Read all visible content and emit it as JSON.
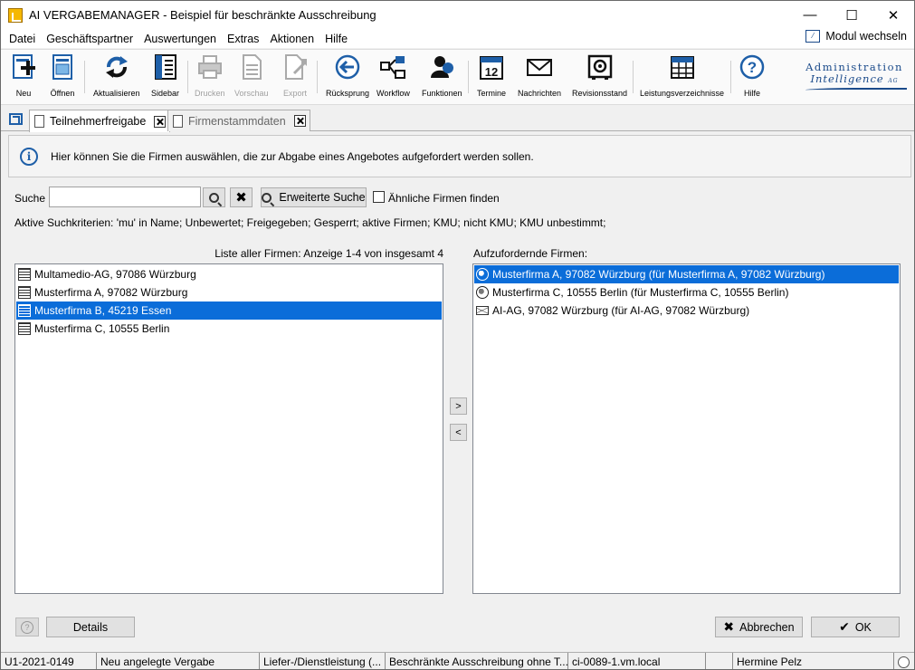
{
  "window": {
    "title": "AI VERGABEMANAGER - Beispiel für beschränkte Ausschreibung",
    "minimize": "—",
    "maximize": "☐",
    "close": "✕"
  },
  "menu": {
    "items": [
      "Datei",
      "Geschäftspartner",
      "Auswertungen",
      "Extras",
      "Aktionen",
      "Hilfe"
    ],
    "modul_wechseln": "Modul wechseln"
  },
  "toolbar": {
    "items": [
      {
        "label": "Neu",
        "icon": "new-document-icon",
        "enabled": true
      },
      {
        "label": "Öffnen",
        "icon": "open-document-icon",
        "enabled": true
      },
      {
        "label": "Aktualisieren",
        "icon": "refresh-icon",
        "enabled": true
      },
      {
        "label": "Sidebar",
        "icon": "sidebar-icon",
        "enabled": true
      },
      {
        "label": "Drucken",
        "icon": "printer-icon",
        "enabled": false
      },
      {
        "label": "Vorschau",
        "icon": "preview-icon",
        "enabled": false
      },
      {
        "label": "Export",
        "icon": "export-icon",
        "enabled": false
      },
      {
        "label": "Rücksprung",
        "icon": "back-arrow-icon",
        "enabled": true
      },
      {
        "label": "Workflow",
        "icon": "workflow-icon",
        "enabled": true
      },
      {
        "label": "Funktionen",
        "icon": "functions-icon",
        "enabled": true
      },
      {
        "label": "Termine",
        "icon": "calendar-icon",
        "enabled": true
      },
      {
        "label": "Nachrichten",
        "icon": "mail-icon",
        "enabled": true
      },
      {
        "label": "Revisionsstand",
        "icon": "safe-icon",
        "enabled": true
      },
      {
        "label": "Leistungsverzeichnisse",
        "icon": "table-icon",
        "enabled": true
      },
      {
        "label": "Hilfe",
        "icon": "help-icon",
        "enabled": true
      }
    ],
    "logo_line1": "Administration",
    "logo_line2": "Intelligence",
    "logo_ag": "AG"
  },
  "tabs": [
    {
      "label": "Teilnehmerfreigabe",
      "active": true
    },
    {
      "label": "Firmenstammdaten",
      "active": false
    }
  ],
  "info": {
    "text": "Hier können Sie die Firmen auswählen, die zur Abgabe eines Angebotes aufgefordert werden sollen."
  },
  "search": {
    "label": "Suche",
    "value": "",
    "advanced_label": "Erweiterte Suche",
    "similar_label": "Ähnliche Firmen finden",
    "similar_checked": false,
    "criteria": "Aktive Suchkriterien: 'mu' in Name; Unbewertet; Freigegeben; Gesperrt; aktive Firmen; KMU; nicht KMU; KMU unbestimmt;"
  },
  "left_list": {
    "header": "Liste aller Firmen:  Anzeige 1-4 von insgesamt 4",
    "items": [
      {
        "label": "Multamedio-AG, 97086 Würzburg",
        "icon": "building-icon",
        "selected": false
      },
      {
        "label": "Musterfirma A, 97082 Würzburg",
        "icon": "building-icon",
        "selected": false
      },
      {
        "label": "Musterfirma B, 45219 Essen",
        "icon": "building-icon",
        "selected": true
      },
      {
        "label": "Musterfirma C, 10555 Berlin",
        "icon": "building-icon",
        "selected": false
      }
    ]
  },
  "right_list": {
    "header": "Aufzufordernde Firmen:",
    "items": [
      {
        "label": "Musterfirma A, 97082 Würzburg (für Musterfirma A, 97082 Würzburg)",
        "icon": "globe-icon",
        "selected": true
      },
      {
        "label": "Musterfirma C, 10555 Berlin (für Musterfirma C, 10555 Berlin)",
        "icon": "globe-icon",
        "selected": false
      },
      {
        "label": "AI-AG, 97082 Würzburg (für AI-AG, 97082 Würzburg)",
        "icon": "envelope-icon",
        "selected": false
      }
    ]
  },
  "move": {
    "add": ">",
    "remove": "<"
  },
  "buttons": {
    "details": "Details",
    "cancel": "Abbrechen",
    "ok": "OK"
  },
  "status": [
    "U1-2021-0149",
    "Neu angelegte Vergabe",
    "Liefer-/Dienstleistung (...",
    "Beschränkte Ausschreibung ohne T...",
    "ci-0089-1.vm.local",
    "",
    "Hermine Pelz"
  ],
  "colors": {
    "selection": "#0b6dd9",
    "accent": "#1e5fa8"
  }
}
